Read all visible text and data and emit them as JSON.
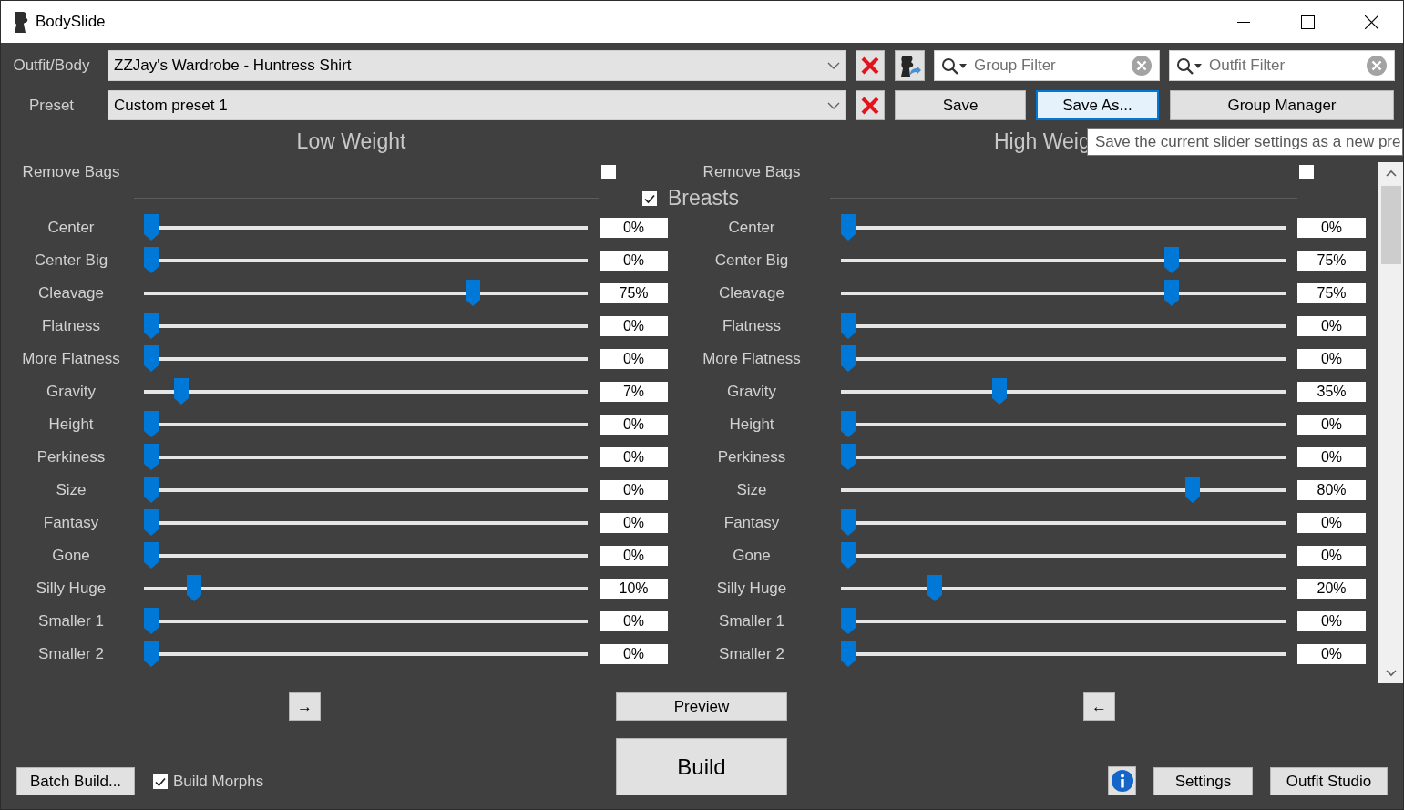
{
  "window": {
    "title": "BodySlide"
  },
  "outfit": {
    "label": "Outfit/Body",
    "value": "ZZJay's Wardrobe - Huntress Shirt"
  },
  "preset": {
    "label": "Preset",
    "value": "Custom preset 1"
  },
  "filters": [
    {
      "placeholder": "Group Filter"
    },
    {
      "placeholder": "Outfit Filter"
    }
  ],
  "preset_buttons": [
    {
      "label": "Save",
      "focused": false
    },
    {
      "label": "Save As...",
      "focused": true
    },
    {
      "label": "Group Manager",
      "focused": false
    }
  ],
  "headers": {
    "low": "Low Weight",
    "high": "High Weig"
  },
  "tooltip": "Save the current slider settings as a new pre",
  "remove_bags": {
    "low": {
      "label": "Remove Bags",
      "checked": false
    },
    "high": {
      "label": "Remove Bags",
      "checked": false
    }
  },
  "group": {
    "label": "Breasts",
    "checked": true
  },
  "sliders": [
    {
      "low": {
        "name": "Center",
        "level": 0,
        "reading": "0%"
      },
      "high": {
        "name": "Center",
        "level": 0,
        "reading": "0%"
      }
    },
    {
      "low": {
        "name": "Center Big",
        "level": 0,
        "reading": "0%"
      },
      "high": {
        "name": "Center Big",
        "level": 0.75,
        "reading": "75%"
      }
    },
    {
      "low": {
        "name": "Cleavage",
        "level": 0.75,
        "reading": "75%"
      },
      "high": {
        "name": "Cleavage",
        "level": 0.75,
        "reading": "75%"
      }
    },
    {
      "low": {
        "name": "Flatness",
        "level": 0,
        "reading": "0%"
      },
      "high": {
        "name": "Flatness",
        "level": 0,
        "reading": "0%"
      }
    },
    {
      "low": {
        "name": "More Flatness",
        "level": 0,
        "reading": "0%"
      },
      "high": {
        "name": "More Flatness",
        "level": 0,
        "reading": "0%"
      }
    },
    {
      "low": {
        "name": "Gravity",
        "level": 0.07,
        "reading": "7%"
      },
      "high": {
        "name": "Gravity",
        "level": 0.35,
        "reading": "35%"
      }
    },
    {
      "low": {
        "name": "Height",
        "level": 0,
        "reading": "0%"
      },
      "high": {
        "name": "Height",
        "level": 0,
        "reading": "0%"
      }
    },
    {
      "low": {
        "name": "Perkiness",
        "level": 0,
        "reading": "0%"
      },
      "high": {
        "name": "Perkiness",
        "level": 0,
        "reading": "0%"
      }
    },
    {
      "low": {
        "name": "Size",
        "level": 0,
        "reading": "0%"
      },
      "high": {
        "name": "Size",
        "level": 0.8,
        "reading": "80%"
      }
    },
    {
      "low": {
        "name": "Fantasy",
        "level": 0,
        "reading": "0%"
      },
      "high": {
        "name": "Fantasy",
        "level": 0,
        "reading": "0%"
      }
    },
    {
      "low": {
        "name": "Gone",
        "level": 0,
        "reading": "0%"
      },
      "high": {
        "name": "Gone",
        "level": 0,
        "reading": "0%"
      }
    },
    {
      "low": {
        "name": "Silly Huge",
        "level": 0.1,
        "reading": "10%"
      },
      "high": {
        "name": "Silly Huge",
        "level": 0.2,
        "reading": "20%"
      }
    },
    {
      "low": {
        "name": "Smaller 1",
        "level": 0,
        "reading": "0%"
      },
      "high": {
        "name": "Smaller 1",
        "level": 0,
        "reading": "0%"
      }
    },
    {
      "low": {
        "name": "Smaller 2",
        "level": 0,
        "reading": "0%"
      },
      "high": {
        "name": "Smaller 2",
        "level": 0,
        "reading": "0%"
      }
    }
  ],
  "footer": {
    "copy_to_high": "→",
    "preview": "Preview",
    "copy_to_low": "←",
    "build": "Build",
    "batch_build": "Batch Build...",
    "build_morphs": {
      "label": "Build Morphs",
      "checked": true
    },
    "settings": "Settings",
    "outfit_studio": "Outfit Studio"
  }
}
